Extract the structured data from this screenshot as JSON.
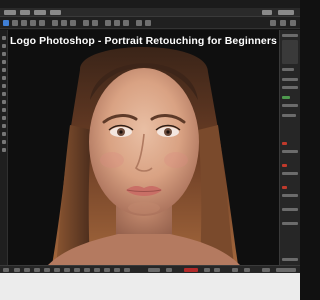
{
  "canvas": {
    "caption": "Logo Photoshop - Portrait Retouching for Beginners"
  },
  "colors": {
    "accent": "#3f7fd6",
    "app_background": "#161616",
    "panel_background": "#262626",
    "record_red": "#b12a2a"
  },
  "icons": {
    "toolbar": "tool-icons",
    "menu": "menu-items",
    "panels": "layer-panel-swatches"
  }
}
